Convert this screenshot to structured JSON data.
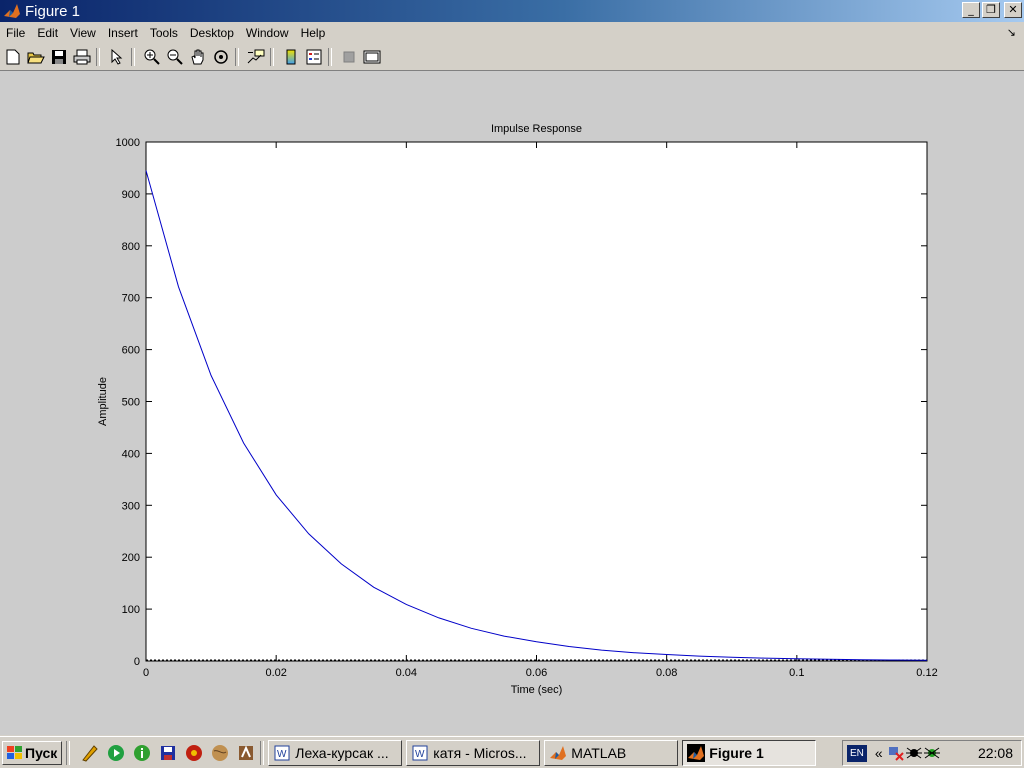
{
  "window": {
    "title": "Figure 1"
  },
  "menubar": {
    "items": [
      "File",
      "Edit",
      "View",
      "Insert",
      "Tools",
      "Desktop",
      "Window",
      "Help"
    ]
  },
  "toolbar": {
    "icons": [
      "new-icon",
      "open-icon",
      "save-icon",
      "print-icon",
      "pointer-icon",
      "zoom-in-icon",
      "zoom-out-icon",
      "pan-icon",
      "rotate-icon",
      "data-cursor-icon",
      "colorbar-icon",
      "legend-icon",
      "hide-tools-icon",
      "show-tools-icon"
    ]
  },
  "chart_data": {
    "type": "line",
    "title": "Impulse Response",
    "xlabel": "Time (sec)",
    "ylabel": "Amplitude",
    "xlim": [
      0,
      0.12
    ],
    "ylim": [
      0,
      1000
    ],
    "xticks": [
      "0",
      "0.02",
      "0.04",
      "0.06",
      "0.08",
      "0.1",
      "0.12"
    ],
    "yticks": [
      "0",
      "100",
      "200",
      "300",
      "400",
      "500",
      "600",
      "700",
      "800",
      "900",
      "1000"
    ],
    "series": [
      {
        "color": "#0000c8",
        "x": [
          0,
          0.005,
          0.01,
          0.015,
          0.02,
          0.025,
          0.03,
          0.035,
          0.04,
          0.045,
          0.05,
          0.055,
          0.06,
          0.065,
          0.07,
          0.075,
          0.08,
          0.085,
          0.09,
          0.095,
          0.1,
          0.105,
          0.11,
          0.115,
          0.12
        ],
        "y": [
          945,
          721,
          550,
          420,
          320,
          245,
          187,
          142,
          109,
          83,
          63,
          48,
          37,
          28,
          21,
          16,
          12.5,
          9.5,
          7.3,
          5.6,
          4.2,
          3.2,
          2.5,
          1.9,
          1.4
        ]
      }
    ],
    "grid": false
  },
  "taskbar": {
    "start_label": "Пуск",
    "tasks": [
      {
        "label": "Леха-курсак ...",
        "icon": "word-icon",
        "active": false
      },
      {
        "label": "катя - Micros...",
        "icon": "word-icon",
        "active": false
      },
      {
        "label": "MATLAB",
        "icon": "matlab-icon",
        "active": false
      },
      {
        "label": "Figure  1",
        "icon": "matlab-icon",
        "active": true
      }
    ],
    "tray": {
      "lang": "EN",
      "chevron": "«",
      "time": "22:08"
    }
  }
}
